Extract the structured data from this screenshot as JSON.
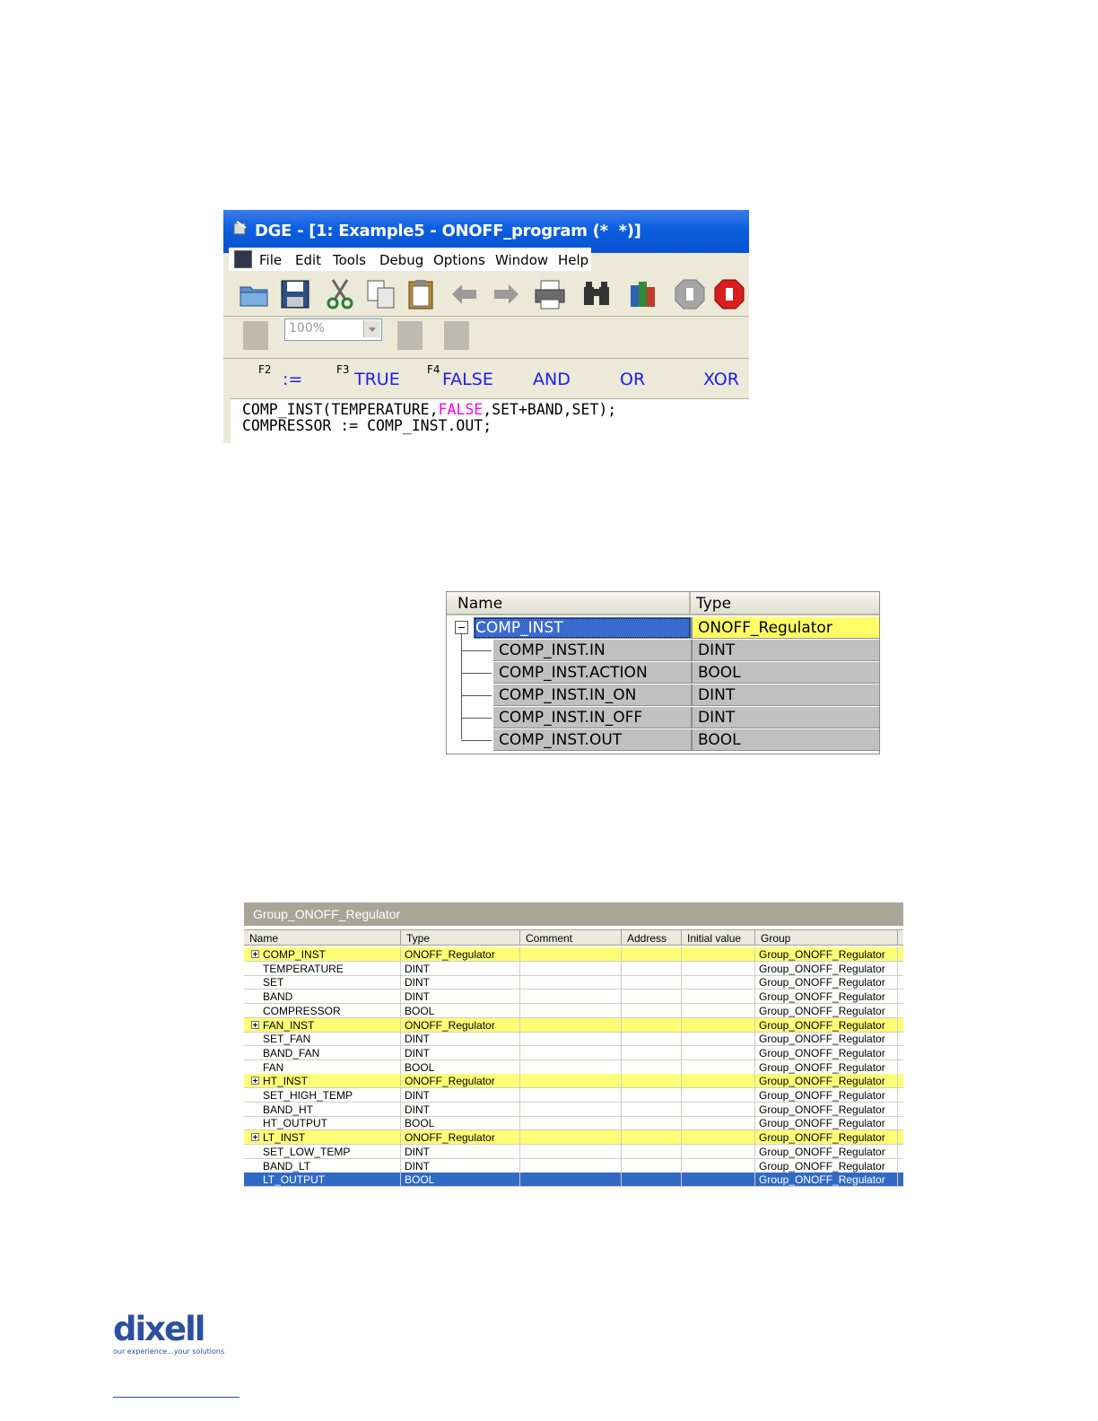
{
  "dge_window": {
    "title": "DGE - [1: Example5 - ONOFF_program (*  *)]",
    "menu": [
      "File",
      "Edit",
      "Tools",
      "Debug",
      "Options",
      "Window",
      "Help"
    ],
    "toolbar_icons": [
      "open-folder-icon",
      "save-icon",
      "cut-icon",
      "copy-icon",
      "paste-icon",
      "undo-icon",
      "redo-icon",
      "print-icon",
      "find-icon",
      "library-icon",
      "stop-icon",
      "stop-all-icon"
    ],
    "zoom_value": "100%",
    "keywords": {
      "f2_key": "F2",
      "assign": ":=",
      "f3_key": "F3",
      "true": "TRUE",
      "f4_key": "F4",
      "false": "FALSE",
      "and": "AND",
      "or": "OR",
      "xor": "XOR"
    },
    "code": {
      "line1_pre": "COMP_INST(TEMPERATURE,",
      "line1_kw": "FALSE",
      "line1_post": ",SET+BAND,SET);",
      "line2": "COMPRESSOR := COMP_INST.OUT;"
    }
  },
  "instance_tree": {
    "headers": {
      "name": "Name",
      "type": "Type"
    },
    "root": {
      "name": "COMP_INST",
      "type": "ONOFF_Regulator"
    },
    "children": [
      {
        "name": "COMP_INST.IN",
        "type": "DINT"
      },
      {
        "name": "COMP_INST.ACTION",
        "type": "BOOL"
      },
      {
        "name": "COMP_INST.IN_ON",
        "type": "DINT"
      },
      {
        "name": "COMP_INST.IN_OFF",
        "type": "DINT"
      },
      {
        "name": "COMP_INST.OUT",
        "type": "BOOL"
      }
    ]
  },
  "group_table": {
    "title": "Group_ONOFF_Regulator",
    "columns": [
      "Name",
      "Type",
      "Comment",
      "Address",
      "Initial value",
      "Group"
    ],
    "rows": [
      {
        "name": "COMP_INST",
        "type": "ONOFF_Regulator",
        "group": "Group_ONOFF_Regulator",
        "expandable": true
      },
      {
        "name": "TEMPERATURE",
        "type": "DINT",
        "group": "Group_ONOFF_Regulator"
      },
      {
        "name": "SET",
        "type": "DINT",
        "group": "Group_ONOFF_Regulator"
      },
      {
        "name": "BAND",
        "type": "DINT",
        "group": "Group_ONOFF_Regulator"
      },
      {
        "name": "COMPRESSOR",
        "type": "BOOL",
        "group": "Group_ONOFF_Regulator"
      },
      {
        "name": "FAN_INST",
        "type": "ONOFF_Regulator",
        "group": "Group_ONOFF_Regulator",
        "expandable": true
      },
      {
        "name": "SET_FAN",
        "type": "DINT",
        "group": "Group_ONOFF_Regulator"
      },
      {
        "name": "BAND_FAN",
        "type": "DINT",
        "group": "Group_ONOFF_Regulator"
      },
      {
        "name": "FAN",
        "type": "BOOL",
        "group": "Group_ONOFF_Regulator"
      },
      {
        "name": "HT_INST",
        "type": "ONOFF_Regulator",
        "group": "Group_ONOFF_Regulator",
        "expandable": true
      },
      {
        "name": "SET_HIGH_TEMP",
        "type": "DINT",
        "group": "Group_ONOFF_Regulator"
      },
      {
        "name": "BAND_HT",
        "type": "DINT",
        "group": "Group_ONOFF_Regulator"
      },
      {
        "name": "HT_OUTPUT",
        "type": "BOOL",
        "group": "Group_ONOFF_Regulator"
      },
      {
        "name": "LT_INST",
        "type": "ONOFF_Regulator",
        "group": "Group_ONOFF_Regulator",
        "expandable": true
      },
      {
        "name": "SET_LOW_TEMP",
        "type": "DINT",
        "group": "Group_ONOFF_Regulator"
      },
      {
        "name": "BAND_LT",
        "type": "DINT",
        "group": "Group_ONOFF_Regulator"
      },
      {
        "name": "LT_OUTPUT",
        "type": "BOOL",
        "group": "Group_ONOFF_Regulator",
        "selected": true
      }
    ]
  },
  "logo": {
    "word": "dixell",
    "tagline": "our experience...your solutions"
  }
}
